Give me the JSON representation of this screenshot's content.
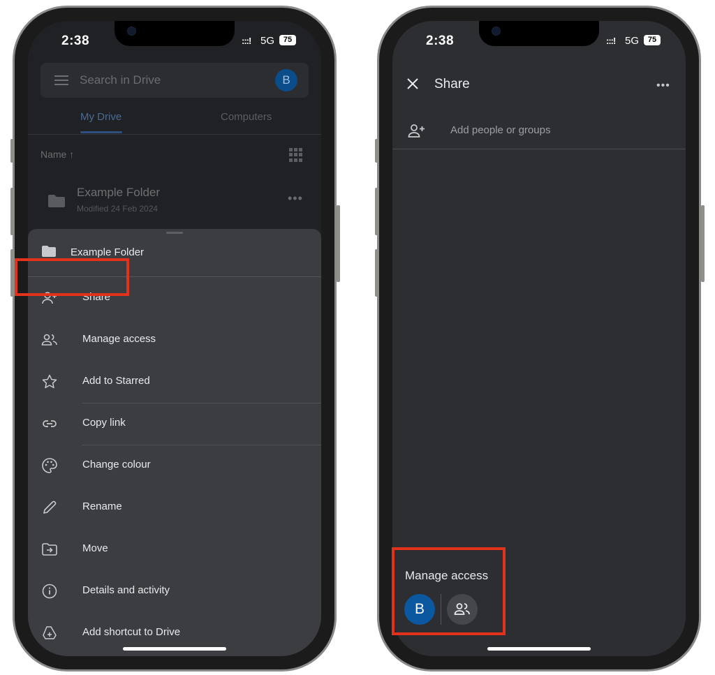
{
  "left_phone": {
    "status_bar": {
      "time": "2:38",
      "signal": ":::!",
      "network": "5G",
      "battery": "75"
    },
    "search": {
      "placeholder": "Search in Drive",
      "avatar_initial": "B"
    },
    "tabs": [
      {
        "label": "My Drive"
      },
      {
        "label": "Computers"
      }
    ],
    "sort_label": "Name ↑",
    "file": {
      "name": "Example Folder",
      "modified": "Modified 24 Feb 2024",
      "more": "•••"
    },
    "sheet": {
      "title": "Example Folder",
      "items": [
        {
          "label": "Share",
          "icon": "person-add-icon"
        },
        {
          "label": "Manage access",
          "icon": "people-icon"
        },
        {
          "label": "Add to Starred",
          "icon": "star-icon"
        },
        {
          "label": "Copy link",
          "icon": "link-icon"
        },
        {
          "label": "Change colour",
          "icon": "palette-icon"
        },
        {
          "label": "Rename",
          "icon": "pencil-icon"
        },
        {
          "label": "Move",
          "icon": "move-folder-icon"
        },
        {
          "label": "Details and activity",
          "icon": "info-icon"
        },
        {
          "label": "Add shortcut to Drive",
          "icon": "drive-shortcut-icon"
        }
      ]
    }
  },
  "right_phone": {
    "status_bar": {
      "time": "2:38",
      "signal": ":::!",
      "network": "5G",
      "battery": "75"
    },
    "appbar": {
      "title": "Share",
      "more": "•••"
    },
    "add_people_placeholder": "Add people or groups",
    "manage_access": {
      "title": "Manage access",
      "avatar_initial": "B"
    }
  },
  "colors": {
    "highlight": "#e3321b",
    "sheet_bg": "#3c3d40",
    "screen_bg": "#2d2e31",
    "avatar_blue": "#0b57a0"
  }
}
